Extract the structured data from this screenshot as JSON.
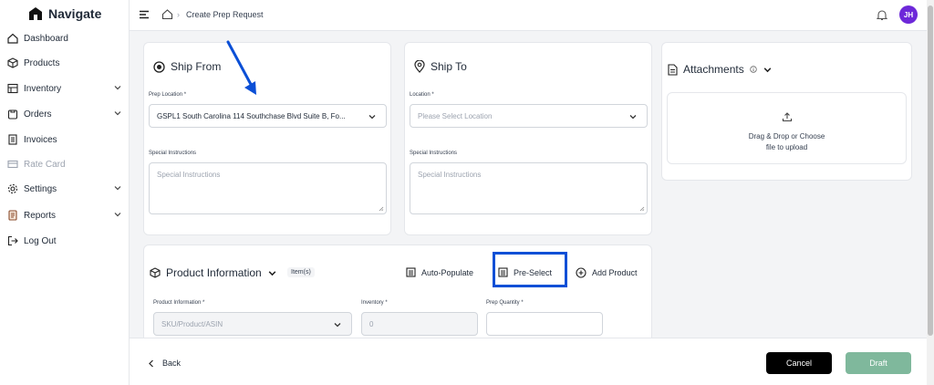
{
  "brand": {
    "name": "Navigate"
  },
  "sidebar": {
    "items": [
      {
        "label": "Dashboard",
        "icon": "home-icon"
      },
      {
        "label": "Products",
        "icon": "box-icon"
      },
      {
        "label": "Inventory",
        "icon": "inventory-icon",
        "expandable": true
      },
      {
        "label": "Orders",
        "icon": "orders-icon",
        "expandable": true
      },
      {
        "label": "Invoices",
        "icon": "invoice-icon"
      },
      {
        "label": "Rate Card",
        "icon": "rate-card-icon",
        "disabled": true
      },
      {
        "label": "Settings",
        "icon": "gear-icon",
        "expandable": true
      },
      {
        "label": "Reports",
        "icon": "reports-icon",
        "expandable": true
      },
      {
        "label": "Log Out",
        "icon": "logout-icon"
      }
    ]
  },
  "topbar": {
    "breadcrumb_title": "Create Prep Request",
    "avatar_initials": "JH"
  },
  "ship_from": {
    "title": "Ship From",
    "location_label": "Prep Location *",
    "location_value": "GSPL1 South Carolina 114 Southchase Blvd Suite B, Fo...",
    "instructions_label": "Special Instructions",
    "instructions_placeholder": "Special Instructions"
  },
  "ship_to": {
    "title": "Ship To",
    "location_label": "Location *",
    "location_placeholder": "Please Select Location",
    "instructions_label": "Special Instructions",
    "instructions_placeholder": "Special Instructions"
  },
  "attachments": {
    "title": "Attachments",
    "drop_line1": "Drag & Drop or Choose",
    "drop_line2": "file to upload"
  },
  "product_info": {
    "title": "Product Information",
    "items_badge": "Item(s)",
    "auto_populate": "Auto-Populate",
    "pre_select": "Pre-Select",
    "add_product": "Add Product",
    "product_label": "Product Information *",
    "product_placeholder": "SKU/Product/ASIN",
    "inventory_label": "Inventory *",
    "inventory_value": "0",
    "prep_qty_label": "Prep Quantity *",
    "prep_qty_value": ""
  },
  "footer": {
    "back_label": "Back",
    "cancel_label": "Cancel",
    "draft_label": "Draft"
  },
  "colors": {
    "accent": "#6d28d9",
    "highlight": "#0b4fd6",
    "draft": "#7fb89c",
    "cancel": "#000000"
  }
}
